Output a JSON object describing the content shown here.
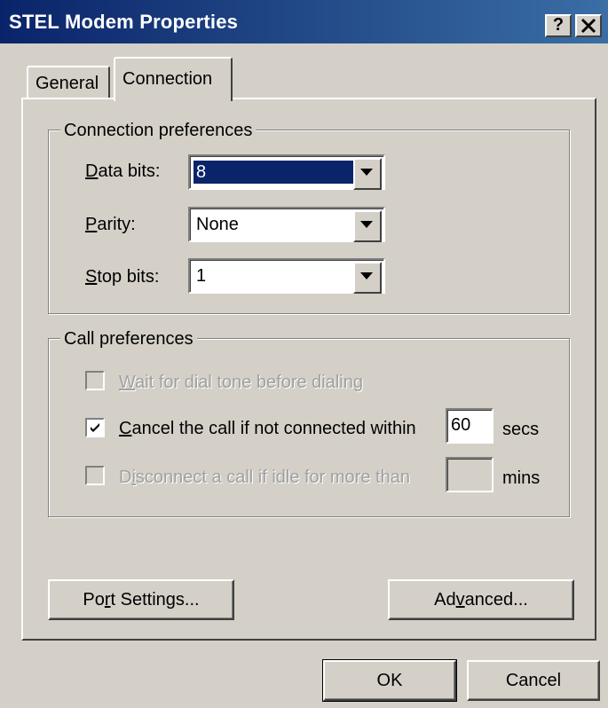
{
  "window": {
    "title": "STEL Modem Properties",
    "help_button": "?",
    "close_button": "✕"
  },
  "tabs": [
    {
      "label": "General",
      "active": false
    },
    {
      "label": "Connection",
      "active": true
    }
  ],
  "connection_preferences": {
    "group_label": "Connection preferences",
    "data_bits": {
      "label_u": "D",
      "label_rest": "ata bits:",
      "value": "8",
      "selected": true
    },
    "parity": {
      "label_u": "P",
      "label_rest": "arity:",
      "value": "None"
    },
    "stop_bits": {
      "label_u": "S",
      "label_rest": "top bits:",
      "value": "1"
    }
  },
  "call_preferences": {
    "group_label": "Call preferences",
    "wait_dial_tone": {
      "label_u": "W",
      "label_rest": "ait for dial tone before dialing",
      "checked": false,
      "enabled": false
    },
    "cancel_call": {
      "label_u": "C",
      "label_rest": "ancel the call if not connected within",
      "checked": true,
      "enabled": true,
      "value": "60",
      "unit": "secs"
    },
    "disconnect_idle": {
      "label_pre": "D",
      "label_u": "i",
      "label_rest": "sconnect a call if idle for more than",
      "checked": false,
      "enabled": false,
      "value": "",
      "unit": "mins"
    }
  },
  "buttons": {
    "port_settings": {
      "pre": "Po",
      "u": "r",
      "post": "t Settings..."
    },
    "advanced": {
      "pre": "Ad",
      "u": "v",
      "post": "anced..."
    },
    "ok": "OK",
    "cancel": "Cancel"
  },
  "colors": {
    "title_bar": "#0a246a",
    "face": "#d4d0c8",
    "selection": "#0a246a"
  }
}
